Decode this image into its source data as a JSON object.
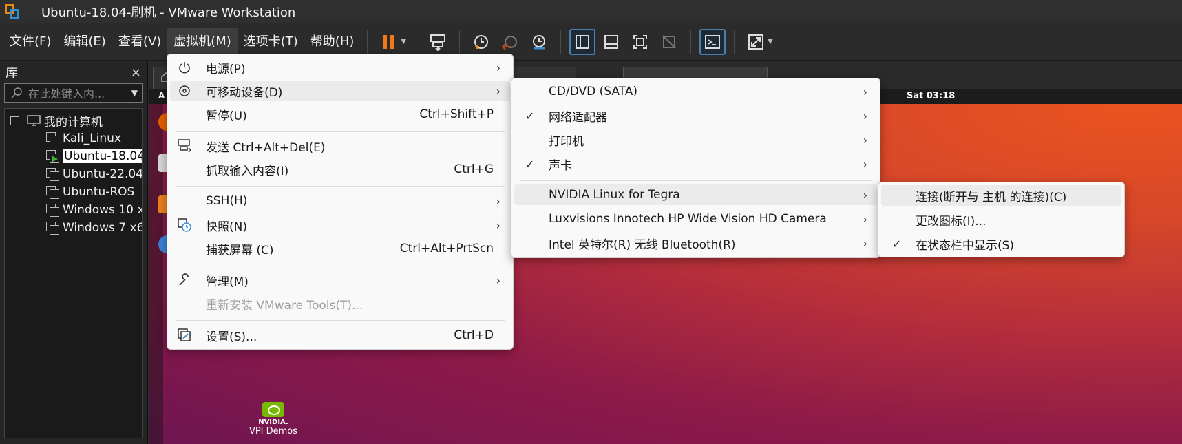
{
  "window": {
    "title": "Ubuntu-18.04-刷机 - VMware Workstation"
  },
  "menubar": {
    "items": [
      "文件(F)",
      "编辑(E)",
      "查看(V)",
      "虚拟机(M)",
      "选项卡(T)",
      "帮助(H)"
    ],
    "toolbar_icons": [
      "pause-icon",
      "send-keys-icon",
      "snapshot-take-icon",
      "snapshot-revert-icon",
      "snapshot-manager-icon",
      "library-view-icon",
      "thumbnail-view-icon",
      "fullscreen-icon",
      "unity-icon",
      "console-icon",
      "stretch-icon"
    ]
  },
  "library": {
    "title": "库",
    "close": "×",
    "search_placeholder": "在此处键入内...",
    "root": "我的计算机",
    "vms": [
      "Kali_Linux",
      "Ubuntu-18.04",
      "Ubuntu-22.04",
      "Ubuntu-ROS",
      "Windows 10 x",
      "Windows 7 x6"
    ]
  },
  "desktop": {
    "clock": "Sat 03:18",
    "activities": "A",
    "nvidia_brand": "NVIDIA.",
    "nvidia_caption": "VPI Demos"
  },
  "vm_menu": {
    "items": [
      {
        "icon": "power-icon",
        "label": "电源(P)",
        "shortcut": "",
        "submenu": true
      },
      {
        "icon": "removable-device-icon",
        "label": "可移动设备(D)",
        "shortcut": "",
        "submenu": true
      },
      {
        "icon": "",
        "label": "暂停(U)",
        "shortcut": "Ctrl+Shift+P",
        "submenu": false
      },
      {
        "icon": "keyboard-icon",
        "label": "发送 Ctrl+Alt+Del(E)",
        "shortcut": "",
        "submenu": false
      },
      {
        "icon": "",
        "label": "抓取输入内容(I)",
        "shortcut": "Ctrl+G",
        "submenu": false
      },
      {
        "icon": "",
        "label": "SSH(H)",
        "shortcut": "",
        "submenu": true
      },
      {
        "icon": "snapshot-icon",
        "label": "快照(N)",
        "shortcut": "",
        "submenu": true
      },
      {
        "icon": "",
        "label": "捕获屏幕 (C)",
        "shortcut": "Ctrl+Alt+PrtScn",
        "submenu": false
      },
      {
        "icon": "wrench-icon",
        "label": "管理(M)",
        "shortcut": "",
        "submenu": true
      },
      {
        "icon": "",
        "label": "重新安装 VMware Tools(T)...",
        "shortcut": "",
        "submenu": false
      },
      {
        "icon": "settings-icon",
        "label": "设置(S)...",
        "shortcut": "Ctrl+D",
        "submenu": false
      }
    ]
  },
  "removable_menu": {
    "items": [
      {
        "label": "CD/DVD (SATA)",
        "checked": false
      },
      {
        "label": "网络适配器",
        "checked": true
      },
      {
        "label": "打印机",
        "checked": false
      },
      {
        "label": "声卡",
        "checked": true
      },
      {
        "label": "NVIDIA Linux for Tegra",
        "checked": false
      },
      {
        "label": "Luxvisions Innotech HP Wide Vision HD Camera",
        "checked": false
      },
      {
        "label": "Intel 英特尔(R) 无线 Bluetooth(R)",
        "checked": false
      }
    ]
  },
  "device_menu": {
    "items": [
      {
        "label": "连接(断开与 主机 的连接)(C)",
        "checked": false
      },
      {
        "label": "更改图标(I)...",
        "checked": false
      },
      {
        "label": "在状态栏中显示(S)",
        "checked": true
      }
    ]
  },
  "glyphs": {
    "arrow": "›",
    "check": "✓"
  },
  "colors": {
    "accent_orange": "#e8891a",
    "pause_orange": "#f07a1a",
    "ubuntu_orange": "#e95420"
  }
}
